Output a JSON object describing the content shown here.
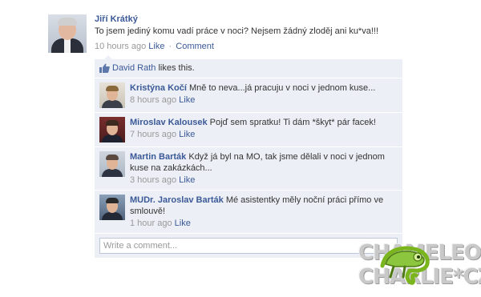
{
  "post": {
    "author": "Jiří Krátký",
    "message": "To jsem jediný komu vadí práce v noci? Nejsem žádný zloděj ani ku*va!!!",
    "time": "10 hours ago",
    "like_label": "Like",
    "separator": "·",
    "comment_label": "Comment"
  },
  "likes": {
    "name": "David Rath",
    "suffix": " likes this."
  },
  "comments": [
    {
      "author": "Kristýna Kočí",
      "message": " Mně to neva...já pracuju v noci v jednom kuse...",
      "time": "8 hours ago",
      "like_label": "Like"
    },
    {
      "author": "Miroslav Kalousek",
      "message": " Pojď sem spratku! Ti dám *škyt* pár facek!",
      "time": "7 hours ago",
      "like_label": "Like"
    },
    {
      "author": "Martin Barták",
      "message": " Když já byl na MO, tak jsme dělali v noci v jednom kuse na zakázkách...",
      "time": "3 hours ago",
      "like_label": "Like"
    },
    {
      "author": "MUDr. Jaroslav Barták",
      "message": " Mé asistentky měly noční práci přímo ve smlouvě!",
      "time": "1 hour ago",
      "like_label": "Like"
    }
  ],
  "write_comment": {
    "placeholder": "Write a comment..."
  },
  "watermark": {
    "line1": "CHAMELEON",
    "line2": "CHARLIE*CZ"
  },
  "colors": {
    "link": "#3b5998",
    "panel": "#eceff5",
    "meta": "#999999"
  }
}
